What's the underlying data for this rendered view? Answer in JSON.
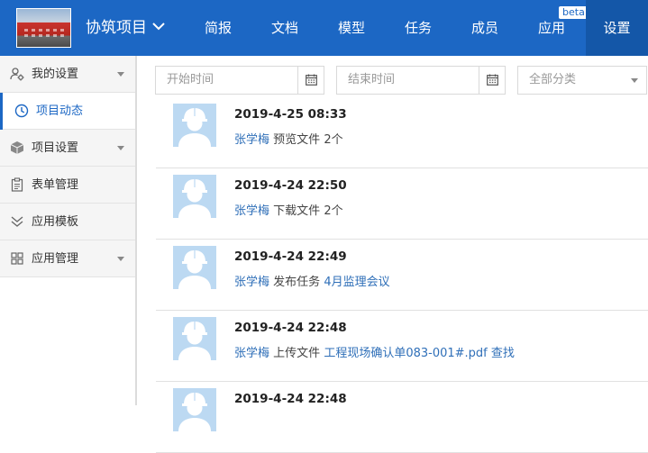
{
  "header": {
    "project_name": "协筑项目",
    "nav": [
      "简报",
      "文档",
      "模型",
      "任务",
      "成员",
      "应用",
      "设置"
    ],
    "beta_badge": "beta",
    "active_nav": "设置"
  },
  "sidebar": {
    "items": [
      {
        "label": "我的设置",
        "icon": "user-gear-icon",
        "has_caret": true
      },
      {
        "label": "项目动态",
        "icon": "clock-icon",
        "active": true
      },
      {
        "label": "项目设置",
        "icon": "box-icon",
        "has_caret": true
      },
      {
        "label": "表单管理",
        "icon": "clipboard-icon"
      },
      {
        "label": "应用模板",
        "icon": "double-chevron-icon"
      },
      {
        "label": "应用管理",
        "icon": "grid-icon",
        "has_caret": true
      }
    ]
  },
  "filters": {
    "start_placeholder": "开始时间",
    "end_placeholder": "结束时间",
    "category_value": "全部分类"
  },
  "feed": [
    {
      "time": "2019-4-25 08:33",
      "user": "张学梅",
      "action": "预览文件",
      "suffix": "2个"
    },
    {
      "time": "2019-4-24 22:50",
      "user": "张学梅",
      "action": "下载文件",
      "suffix": "2个"
    },
    {
      "time": "2019-4-24 22:49",
      "user": "张学梅",
      "action": "发布任务",
      "target": "4月监理会议"
    },
    {
      "time": "2019-4-24 22:48",
      "user": "张学梅",
      "action": "上传文件",
      "target": "工程现场确认单083-001#.pdf",
      "extra_link": "查找"
    },
    {
      "time": "2019-4-24 22:48"
    }
  ],
  "colors": {
    "header_bg": "#1c67c4",
    "header_active": "#1457a8",
    "link": "#2f6fb8"
  }
}
